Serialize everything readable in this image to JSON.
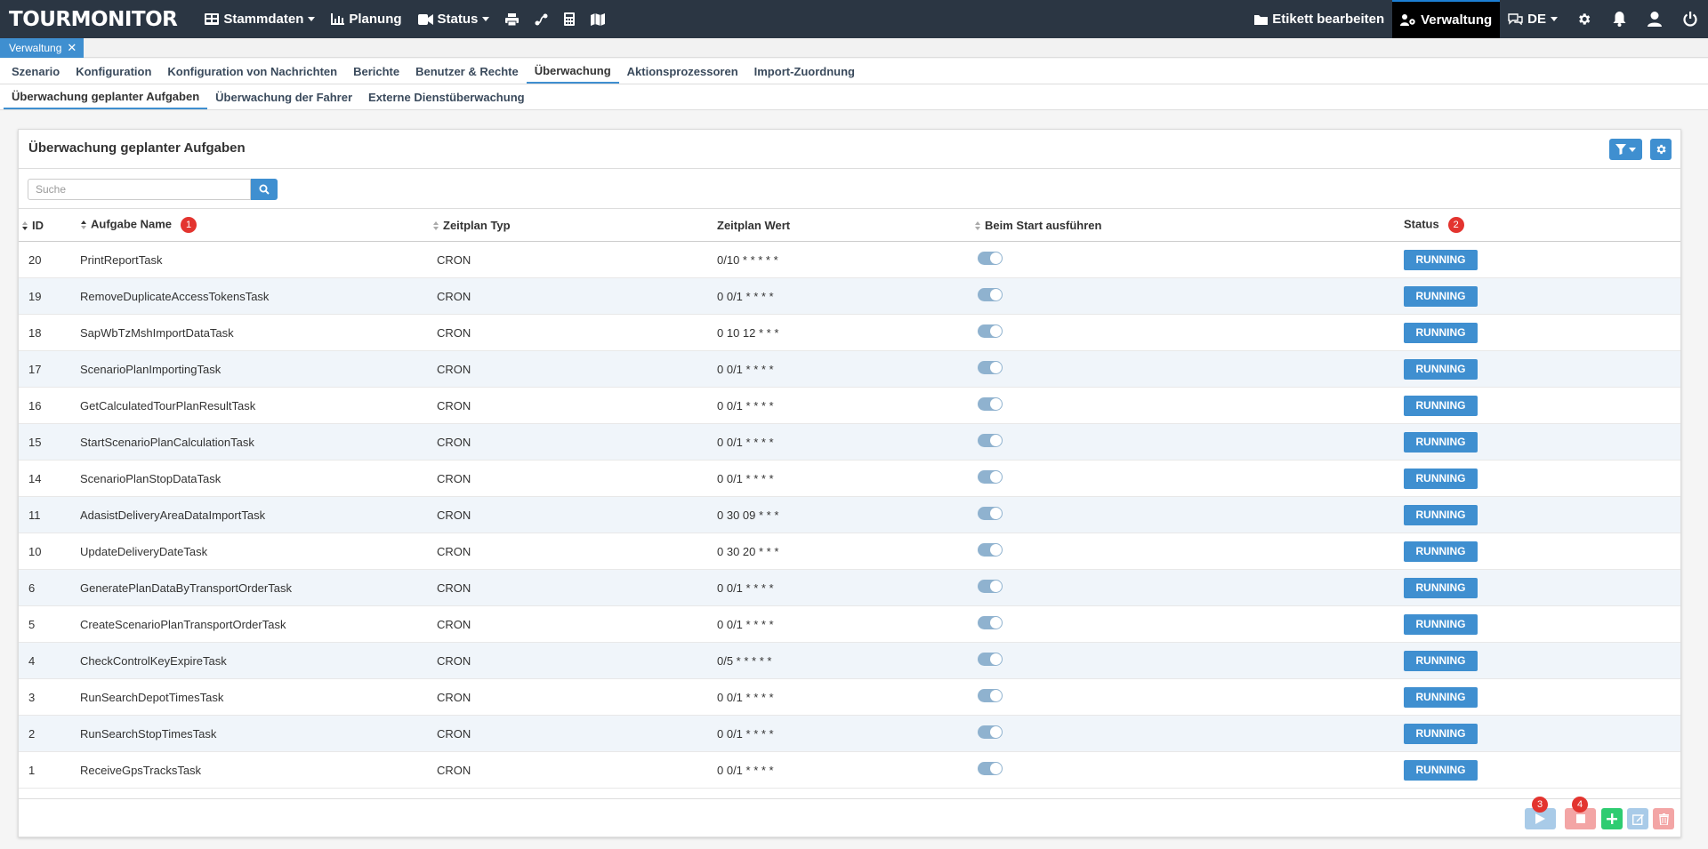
{
  "app": {
    "brand": "TOURMONITOR"
  },
  "navbar": {
    "stammdaten": "Stammdaten",
    "planung": "Planung",
    "status": "Status",
    "etikett": "Etikett bearbeiten",
    "verwaltung": "Verwaltung",
    "language": "DE"
  },
  "open_tab": {
    "label": "Verwaltung"
  },
  "menu": {
    "items": [
      "Szenario",
      "Konfiguration",
      "Konfiguration von Nachrichten",
      "Berichte",
      "Benutzer & Rechte",
      "Überwachung",
      "Aktionsprozessoren",
      "Import-Zuordnung"
    ],
    "active": "Überwachung"
  },
  "submenu": {
    "items": [
      "Überwachung geplanter Aufgaben",
      "Überwachung der Fahrer",
      "Externe Dienstüberwachung"
    ],
    "active": "Überwachung geplanter Aufgaben"
  },
  "panel": {
    "title": "Überwachung geplanter Aufgaben"
  },
  "search": {
    "placeholder": "Suche"
  },
  "table": {
    "columns": {
      "id": "ID",
      "name": "Aufgabe Name",
      "type": "Zeitplan Typ",
      "value": "Zeitplan Wert",
      "on_start": "Beim Start ausführen",
      "status": "Status"
    },
    "badges": {
      "name": "1",
      "status": "2"
    },
    "rows": [
      {
        "id": "20",
        "name": "PrintReportTask",
        "type": "CRON",
        "value": "0/10 * * * * *",
        "on_start": true,
        "status": "RUNNING"
      },
      {
        "id": "19",
        "name": "RemoveDuplicateAccessTokensTask",
        "type": "CRON",
        "value": "0 0/1 * * * *",
        "on_start": true,
        "status": "RUNNING"
      },
      {
        "id": "18",
        "name": "SapWbTzMshImportDataTask",
        "type": "CRON",
        "value": "0 10 12 * * *",
        "on_start": true,
        "status": "RUNNING"
      },
      {
        "id": "17",
        "name": "ScenarioPlanImportingTask",
        "type": "CRON",
        "value": "0 0/1 * * * *",
        "on_start": true,
        "status": "RUNNING"
      },
      {
        "id": "16",
        "name": "GetCalculatedTourPlanResultTask",
        "type": "CRON",
        "value": "0 0/1 * * * *",
        "on_start": true,
        "status": "RUNNING"
      },
      {
        "id": "15",
        "name": "StartScenarioPlanCalculationTask",
        "type": "CRON",
        "value": "0 0/1 * * * *",
        "on_start": true,
        "status": "RUNNING"
      },
      {
        "id": "14",
        "name": "ScenarioPlanStopDataTask",
        "type": "CRON",
        "value": "0 0/1 * * * *",
        "on_start": true,
        "status": "RUNNING"
      },
      {
        "id": "11",
        "name": "AdasistDeliveryAreaDataImportTask",
        "type": "CRON",
        "value": "0 30 09 * * *",
        "on_start": true,
        "status": "RUNNING"
      },
      {
        "id": "10",
        "name": "UpdateDeliveryDateTask",
        "type": "CRON",
        "value": "0 30 20 * * *",
        "on_start": true,
        "status": "RUNNING"
      },
      {
        "id": "6",
        "name": "GeneratePlanDataByTransportOrderTask",
        "type": "CRON",
        "value": "0 0/1 * * * *",
        "on_start": true,
        "status": "RUNNING"
      },
      {
        "id": "5",
        "name": "CreateScenarioPlanTransportOrderTask",
        "type": "CRON",
        "value": "0 0/1 * * * *",
        "on_start": true,
        "status": "RUNNING"
      },
      {
        "id": "4",
        "name": "CheckControlKeyExpireTask",
        "type": "CRON",
        "value": "0/5 * * * * *",
        "on_start": true,
        "status": "RUNNING"
      },
      {
        "id": "3",
        "name": "RunSearchDepotTimesTask",
        "type": "CRON",
        "value": "0 0/1 * * * *",
        "on_start": true,
        "status": "RUNNING"
      },
      {
        "id": "2",
        "name": "RunSearchStopTimesTask",
        "type": "CRON",
        "value": "0 0/1 * * * *",
        "on_start": true,
        "status": "RUNNING"
      },
      {
        "id": "1",
        "name": "ReceiveGpsTracksTask",
        "type": "CRON",
        "value": "0 0/1 * * * *",
        "on_start": true,
        "status": "RUNNING"
      }
    ]
  },
  "footer": {
    "badges": {
      "start": "3",
      "stop": "4"
    },
    "icons": [
      "play-icon",
      "stop-icon",
      "plus-icon",
      "edit-icon",
      "trash-icon"
    ]
  },
  "colors": {
    "navbar": "#2b3643",
    "accent": "#3f8fd0",
    "badge": "#e3342f",
    "add": "#2ecc71",
    "delete": "#f08a8a"
  }
}
